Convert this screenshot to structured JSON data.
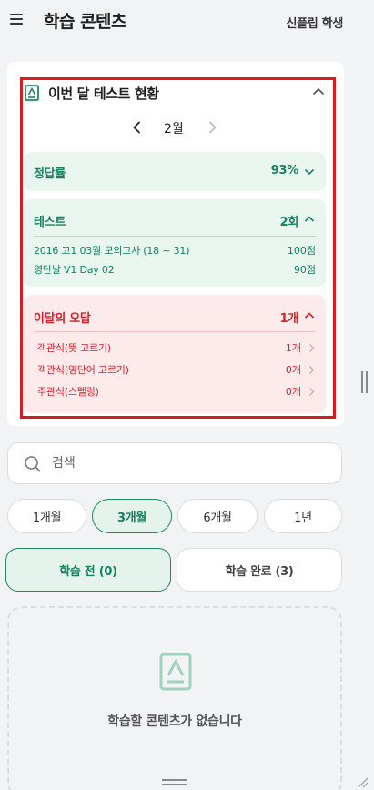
{
  "header": {
    "title": "학습 콘텐츠",
    "user": "신플립 학생"
  },
  "test_status": {
    "title": "이번 달 테스트 현황",
    "month": "2월",
    "accuracy": {
      "label": "정답률",
      "value": "93%"
    },
    "tests": {
      "label": "테스트",
      "value": "2회",
      "items": [
        {
          "name": "2016 고1 03월 모의고사 (18 ~ 31)",
          "score": "100점"
        },
        {
          "name": "영단날 V1 Day 02",
          "score": "90점"
        }
      ]
    },
    "wrong": {
      "label": "이달의 오답",
      "value": "1개",
      "items": [
        {
          "name": "객관식(뜻 고르기)",
          "count": "1개"
        },
        {
          "name": "객관식(영단어 고르기)",
          "count": "0개"
        },
        {
          "name": "주관식(스펠링)",
          "count": "0개"
        }
      ]
    }
  },
  "search": {
    "placeholder": "검색"
  },
  "periods": [
    "1개월",
    "3개월",
    "6개월",
    "1년"
  ],
  "active_period": "3개월",
  "status_tabs": [
    "학습 전 (0)",
    "학습 완료 (3)"
  ],
  "active_status_tab": "학습 전 (0)",
  "empty": {
    "message": "학습할 콘텐츠가 없습니다"
  },
  "colors": {
    "accent_green": "#16815a",
    "accent_red": "#d4202a",
    "highlight_border": "#d81b20"
  },
  "icons": [
    "menu-icon",
    "book-icon",
    "chevron-up-icon",
    "chevron-left-icon",
    "chevron-right-icon",
    "chevron-down-icon",
    "search-icon"
  ]
}
